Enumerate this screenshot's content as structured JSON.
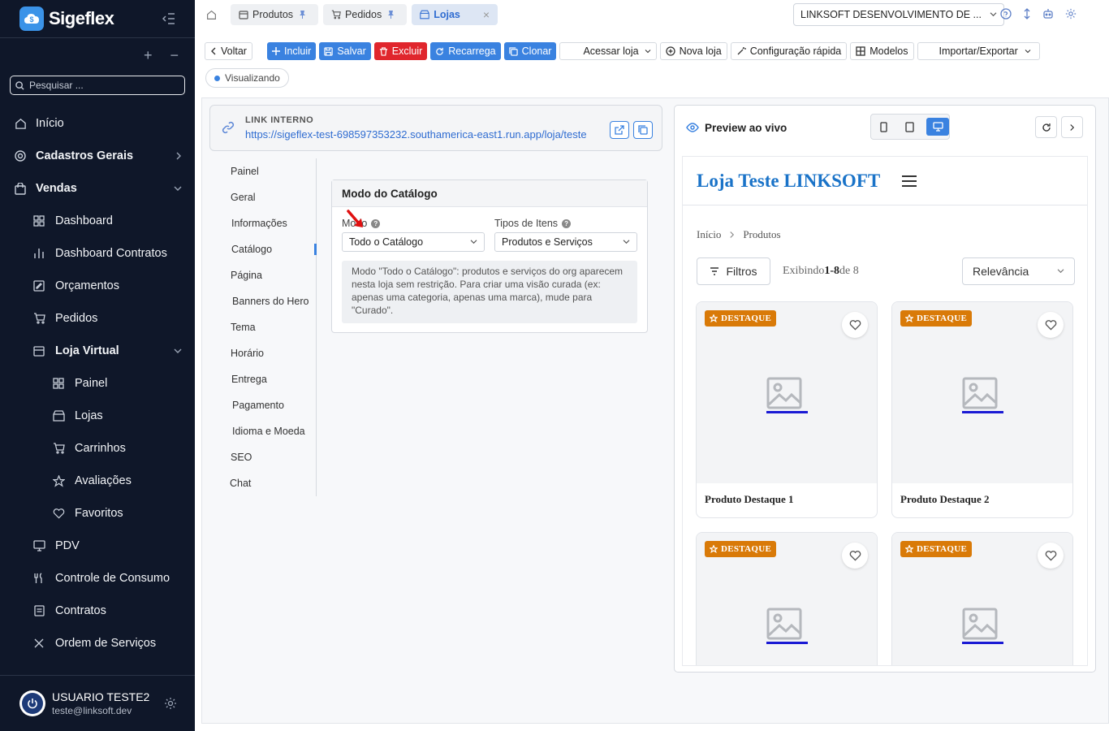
{
  "app": {
    "name": "Sigeflex"
  },
  "sidebar": {
    "search_placeholder": "Pesquisar ...",
    "items": [
      {
        "label": "Início",
        "level": 0
      },
      {
        "label": "Cadastros Gerais",
        "level": 0,
        "bold": true,
        "chevron": "right"
      },
      {
        "label": "Vendas",
        "level": 0,
        "bold": true,
        "chevron": "down"
      },
      {
        "label": "Dashboard",
        "level": 1
      },
      {
        "label": "Dashboard Contratos",
        "level": 1
      },
      {
        "label": "Orçamentos",
        "level": 1
      },
      {
        "label": "Pedidos",
        "level": 1
      },
      {
        "label": "Loja Virtual",
        "level": 1,
        "bold": true,
        "chevron": "down"
      },
      {
        "label": "Painel",
        "level": 2
      },
      {
        "label": "Lojas",
        "level": 2
      },
      {
        "label": "Carrinhos",
        "level": 2
      },
      {
        "label": "Avaliações",
        "level": 2
      },
      {
        "label": "Favoritos",
        "level": 2
      },
      {
        "label": "PDV",
        "level": 1
      },
      {
        "label": "Controle de Consumo",
        "level": 1
      },
      {
        "label": "Contratos",
        "level": 1
      },
      {
        "label": "Ordem de Serviços",
        "level": 1
      }
    ],
    "user": {
      "name": "USUARIO TESTE2",
      "email": "teste@linksoft.dev"
    }
  },
  "tabs": [
    {
      "label": "Produtos",
      "pinned": true
    },
    {
      "label": "Pedidos",
      "pinned": true
    },
    {
      "label": "Lojas",
      "active": true
    }
  ],
  "company_select": {
    "value": "LINKSOFT DESENVOLVIMENTO DE ..."
  },
  "toolbar": {
    "back": "Voltar",
    "add": "Incluir",
    "save": "Salvar",
    "delete": "Excluir",
    "reload": "Recarrega",
    "clone": "Clonar",
    "access_store": "Acessar loja",
    "new_store": "Nova loja",
    "quick_config": "Configuração rápida",
    "models": "Modelos",
    "import_export": "Importar/Exportar"
  },
  "status": {
    "label": "Visualizando",
    "color": "#3a82e0"
  },
  "link_card": {
    "label": "LINK INTERNO",
    "url": "https://sigeflex-test-698597353232.southamerica-east1.run.app/loja/teste"
  },
  "subnav": {
    "items": [
      "Painel",
      "Geral",
      "Informações",
      "Catálogo",
      "Página",
      "Banners do Hero",
      "Tema",
      "Horário",
      "Entrega",
      "Pagamento",
      "Idioma e Moeda",
      "SEO",
      "Chat"
    ],
    "active": "Catálogo"
  },
  "catalog": {
    "title": "Modo do Catálogo",
    "mode_label": "Modo",
    "mode_value": "Todo o Catálogo",
    "types_label": "Tipos de Itens",
    "types_value": "Produtos e Serviços",
    "help": "Modo \"Todo o Catálogo\": produtos e serviços do org aparecem nesta loja sem restrição. Para criar uma visão curada (ex: apenas uma categoria, apenas uma marca), mude para \"Curado\"."
  },
  "preview": {
    "title": "Preview ao vivo",
    "store_name": "Loja Teste LINKSOFT",
    "breadcrumb": [
      "Início",
      "Produtos"
    ],
    "filters": "Filtros",
    "showing_prefix": "Exibindo",
    "showing_range": "1-8",
    "showing_suffix": "de 8",
    "sort": "Relevância",
    "badge": "DESTAQUE",
    "products": [
      "Produto Destaque 1",
      "Produto Destaque 2",
      "",
      ""
    ]
  }
}
